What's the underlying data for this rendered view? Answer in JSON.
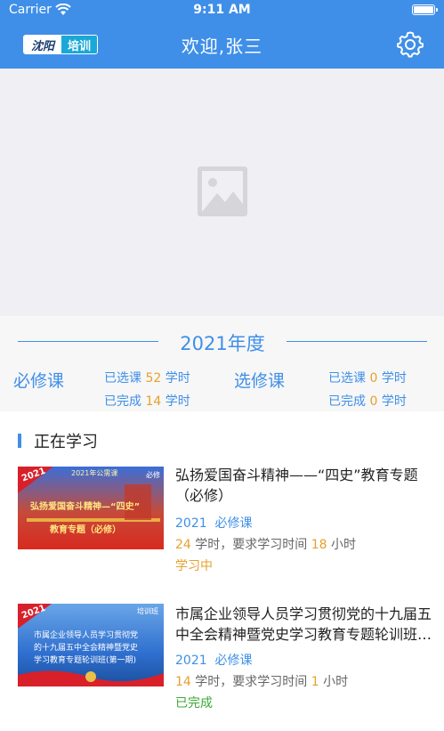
{
  "status_bar": {
    "carrier": "Carrier",
    "time": "9:11 AM"
  },
  "header": {
    "logo_left": "沈阳",
    "logo_right": "培训",
    "title": "欢迎,张三",
    "settings_icon": "gear-icon",
    "background": "#3f8fe8"
  },
  "banner": {
    "placeholder_icon": "image-placeholder-icon"
  },
  "year": {
    "title": "2021年度",
    "required": {
      "label": "必修课",
      "selected_prefix": "已选课",
      "selected_value": "52",
      "completed_prefix": "已完成",
      "completed_value": "14",
      "unit": "学时"
    },
    "elective": {
      "label": "选修课",
      "selected_prefix": "已选课",
      "selected_value": "0",
      "completed_prefix": "已完成",
      "completed_value": "0",
      "unit": "学时"
    }
  },
  "section": {
    "title": "正在学习"
  },
  "courses": [
    {
      "title": "弘扬爱国奋斗精神——“四史”教育专题（必修）",
      "year": "2021",
      "type": "必修课",
      "hours": "24",
      "hours_unit": "学时，要求学习时间",
      "required_time": "18",
      "time_unit": "小时",
      "status": "学习中",
      "status_color": "#e6a02d",
      "thumb": {
        "year": "2021",
        "top_tag": "2021年公需课",
        "badge": "必修",
        "line1": "弘扬爱国奋斗精神—“四史”",
        "line2": "教育专题（必修）"
      }
    },
    {
      "title": "市属企业领导人员学习贯彻党的十九届五中全会精神暨党史学习教育专题轮训班（第一期）",
      "year": "2021",
      "type": "必修课",
      "hours": "14",
      "hours_unit": "学时，要求学习时间",
      "required_time": "1",
      "time_unit": "小时",
      "status": "已完成",
      "status_color": "#3aaa35",
      "thumb": {
        "year": "2021",
        "badge": "培训班",
        "line1": "市属企业领导人员学习贯彻党",
        "line2": "的十九届五中全会精神暨党史",
        "line3": "学习教育专题轮训班(第一期)"
      }
    }
  ]
}
